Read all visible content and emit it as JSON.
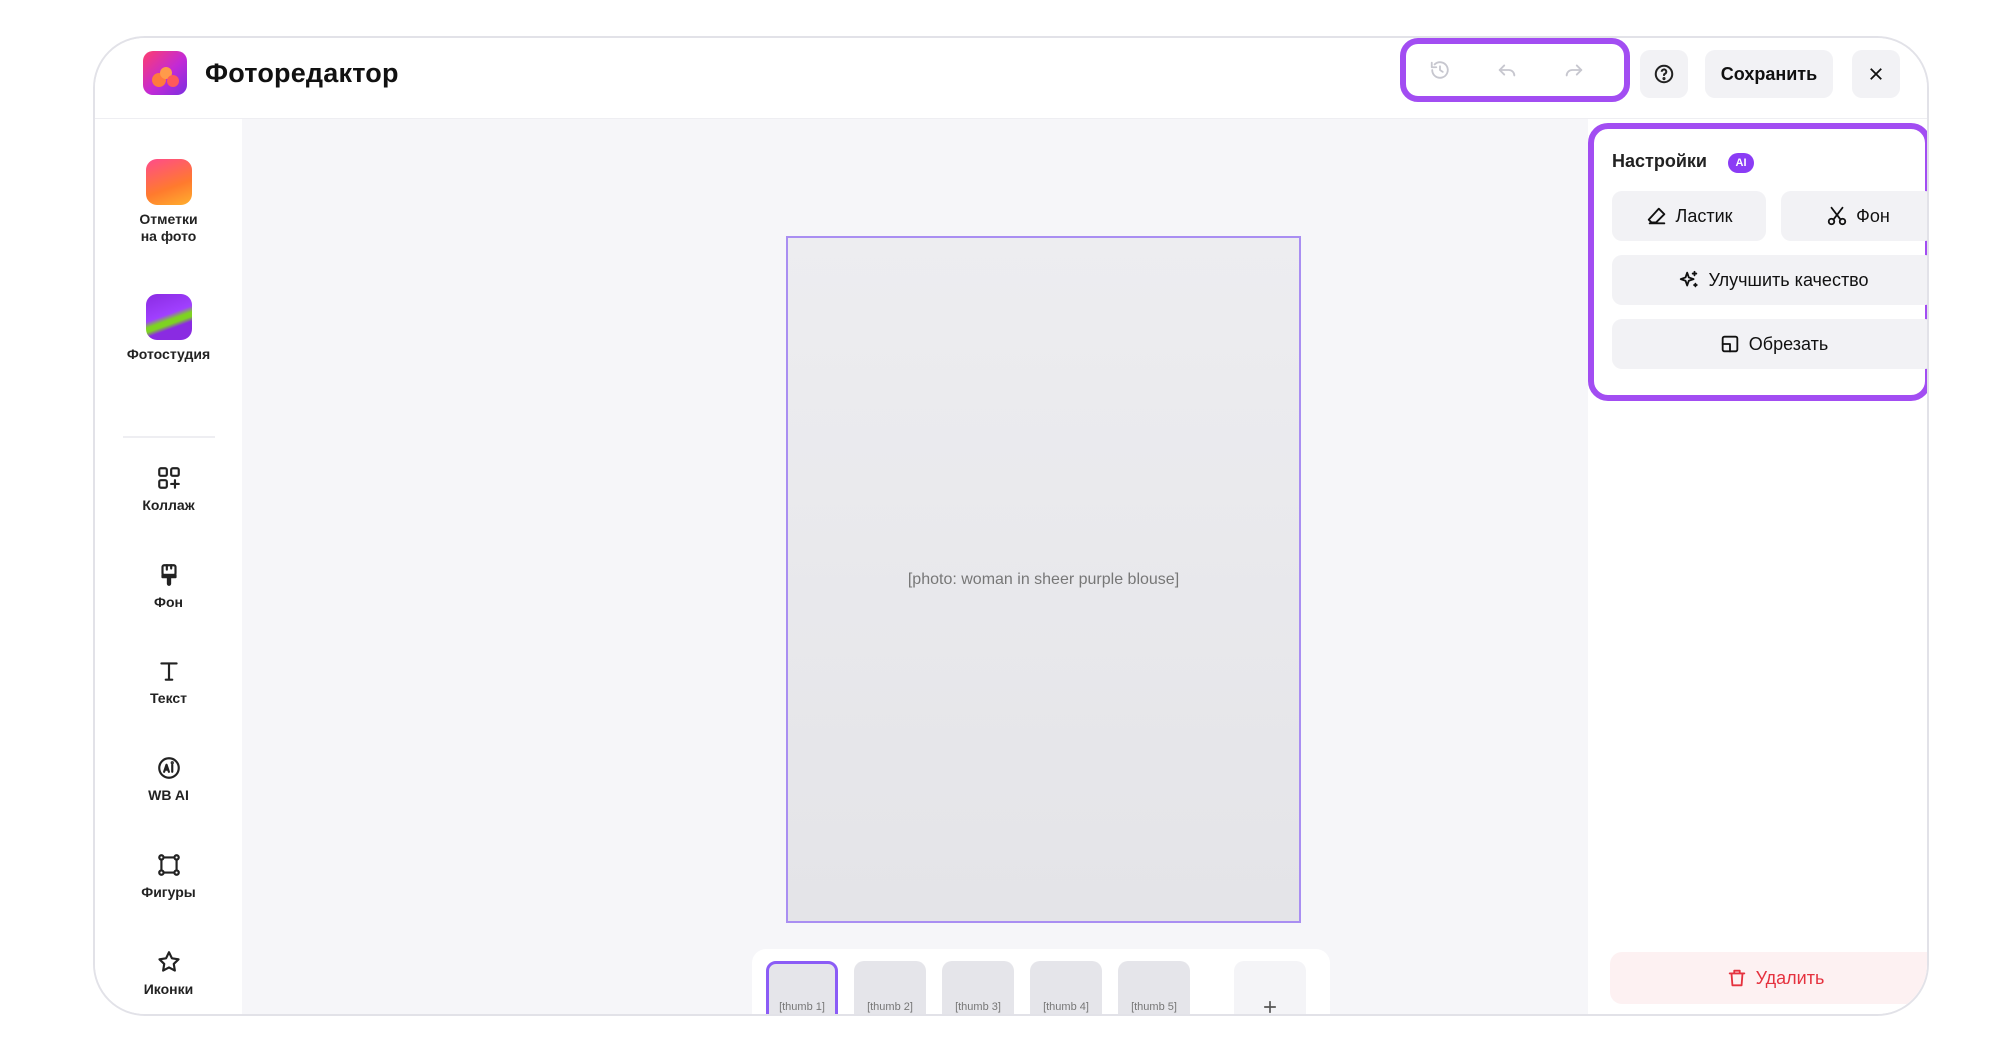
{
  "header": {
    "app_title": "Фоторедактор",
    "save_label": "Сохранить"
  },
  "sidebar": {
    "items": [
      {
        "label": "Отметки\nна фото",
        "icon": "photo-tags-icon"
      },
      {
        "label": "Фотостудия",
        "icon": "photo-studio-icon"
      },
      {
        "label": "Коллаж",
        "icon": "collage-icon"
      },
      {
        "label": "Фон",
        "icon": "background-brush-icon"
      },
      {
        "label": "Текст",
        "icon": "text-icon"
      },
      {
        "label": "WB AI",
        "icon": "ai-icon"
      },
      {
        "label": "Фигуры",
        "icon": "shapes-icon"
      },
      {
        "label": "Иконки",
        "icon": "star-icon"
      }
    ]
  },
  "canvas": {
    "photo_placeholder": "[photo: woman in sheer purple blouse]",
    "thumbnails": [
      {
        "placeholder": "[thumb 1]",
        "active": true,
        "tagged": false
      },
      {
        "placeholder": "[thumb 2]",
        "active": false,
        "tagged": false
      },
      {
        "placeholder": "[thumb 3]",
        "active": false,
        "tagged": true
      },
      {
        "placeholder": "[thumb 4]",
        "active": false,
        "tagged": true
      },
      {
        "placeholder": "[thumb 5]",
        "active": false,
        "tagged": false
      }
    ]
  },
  "panel": {
    "settings_title": "Настройки",
    "ai_badge": "AI",
    "eraser_label": "Ластик",
    "background_label": "Фон",
    "enhance_label": "Улучшить качество",
    "crop_label": "Обрезать",
    "delete_label": "Удалить"
  },
  "colors": {
    "accent": "#a24df2",
    "ai_badge": "#8b3cf5",
    "danger": "#e5323f",
    "danger_bg": "#fdf1f2",
    "button_bg": "#f2f2f5"
  }
}
